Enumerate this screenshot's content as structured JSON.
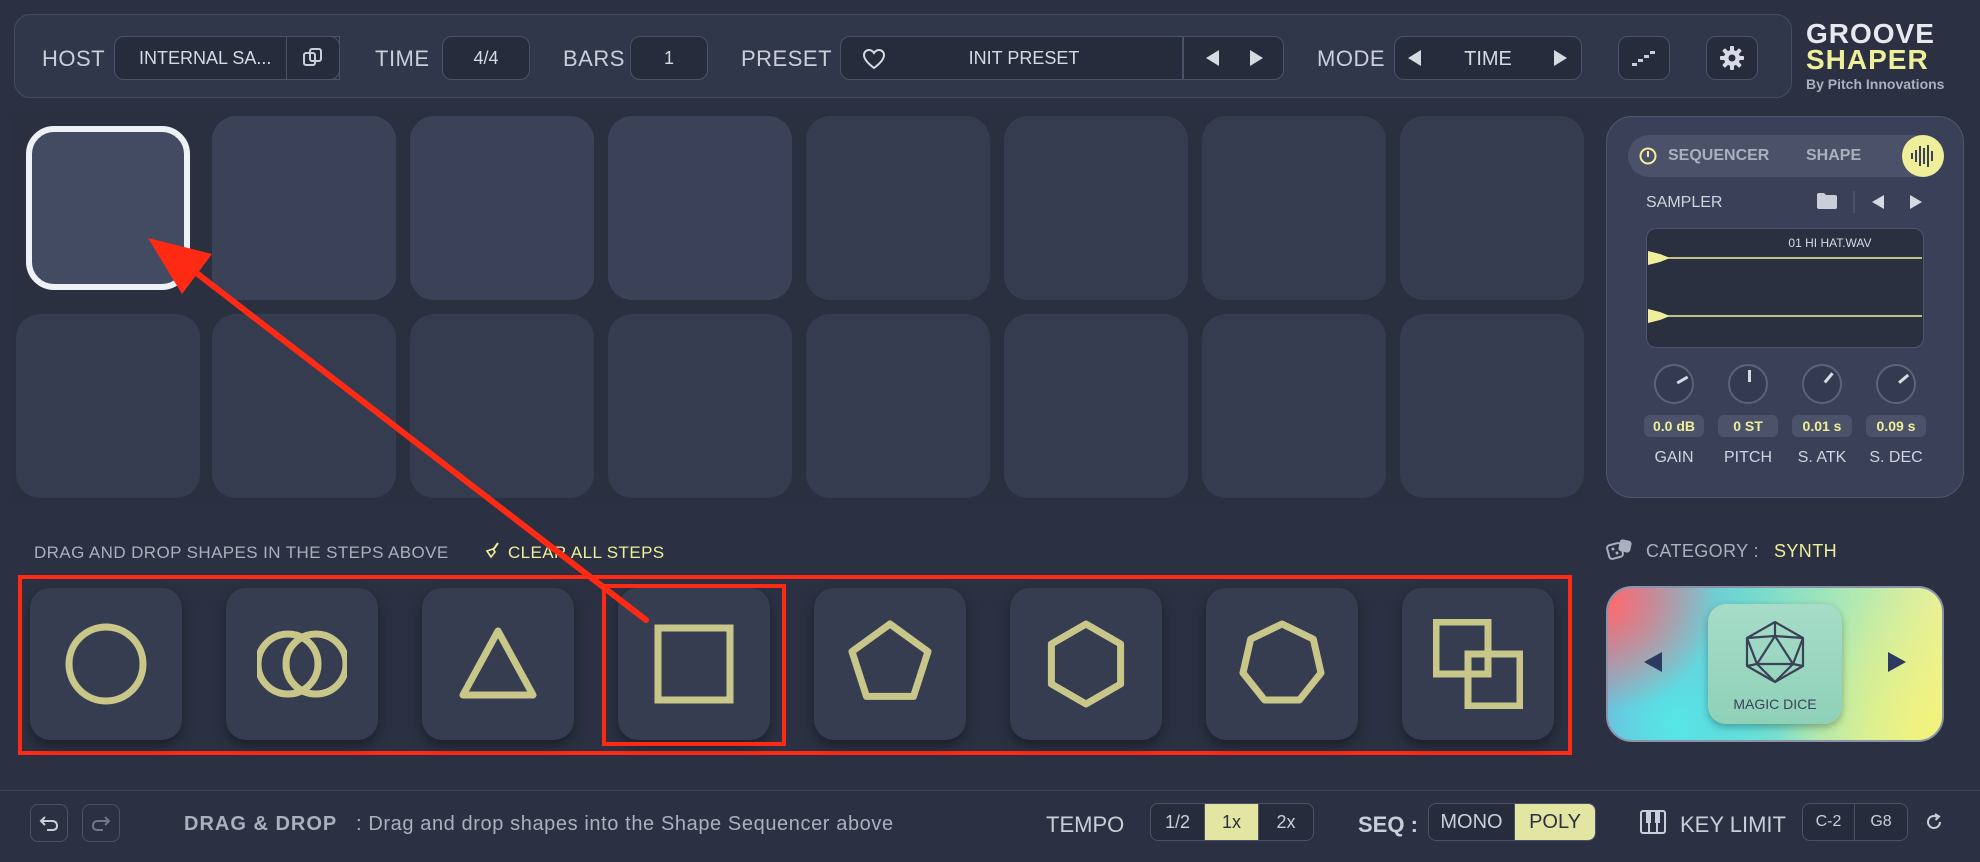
{
  "topbar": {
    "host_label": "HOST",
    "host_value": "INTERNAL SA...",
    "time_label": "TIME",
    "time_value": "4/4",
    "bars_label": "BARS",
    "bars_value": "1",
    "preset_label": "PRESET",
    "preset_value": "INIT PRESET",
    "mode_label": "MODE",
    "mode_value": "TIME"
  },
  "logo": {
    "line1": "GROOVE",
    "line2": "SHAPER",
    "byline": "By Pitch Innovations"
  },
  "sequencer": {
    "selected_step": 1,
    "rows": 2,
    "cols": 8
  },
  "right_panel": {
    "tab_sequencer": "SEQUENCER",
    "tab_shape": "SHAPE",
    "sampler_label": "SAMPLER",
    "sample_name": "01 HI HAT.WAV",
    "knobs": [
      {
        "label": "GAIN",
        "value": "0.0 dB"
      },
      {
        "label": "PITCH",
        "value": "0 ST"
      },
      {
        "label": "S. ATK",
        "value": "0.01 s"
      },
      {
        "label": "S. DEC",
        "value": "0.09 s"
      }
    ]
  },
  "shapes": {
    "hint": "DRAG AND DROP SHAPES IN THE STEPS ABOVE",
    "clear_label": "CLEAR ALL STEPS",
    "items": [
      "circle-icon",
      "double-circle-icon",
      "triangle-icon",
      "square-icon",
      "pentagon-icon",
      "hexagon-icon",
      "heptagon-icon",
      "double-square-icon"
    ],
    "shape_color": "#c9c68a"
  },
  "category": {
    "label": "CATEGORY :",
    "value": "SYNTH",
    "dice_label": "MAGIC DICE"
  },
  "bottombar": {
    "hint_bold": "DRAG & DROP",
    "hint_text": ": Drag and drop shapes into the Shape Sequencer above",
    "tempo_label": "TEMPO",
    "tempo_options": [
      "1/2",
      "1x",
      "2x"
    ],
    "tempo_selected": "1x",
    "seq_label": "SEQ :",
    "seq_options": [
      "MONO",
      "POLY"
    ],
    "seq_selected": "POLY",
    "key_limit_label": "KEY LIMIT",
    "key_low": "C-2",
    "key_high": "G8"
  },
  "colors": {
    "accent_yellow": "#efef9a",
    "annotation_red": "#ff2a14"
  }
}
